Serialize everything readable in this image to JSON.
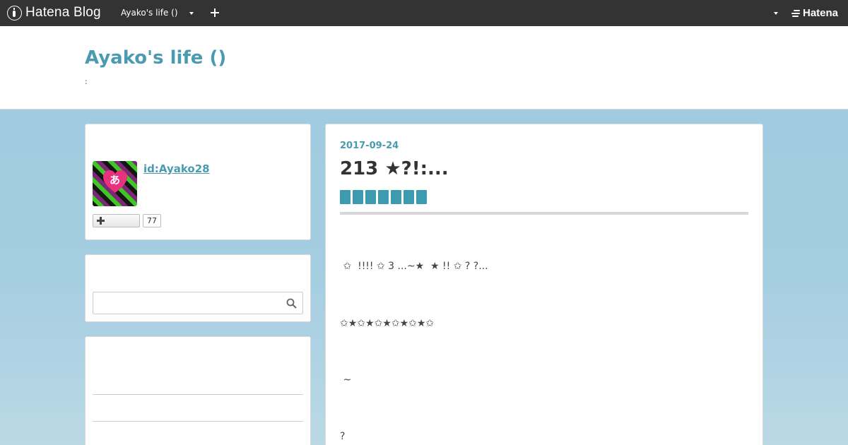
{
  "globalbar": {
    "logo_text": "Hatena Blog",
    "blog_name": "Ayako's life ()",
    "hatena_text": "Hatena"
  },
  "header": {
    "title": "Ayako's life ()",
    "description": ":"
  },
  "profile": {
    "avatar_char": "あ",
    "id": "id:Ayako28",
    "follower_count": "77"
  },
  "search": {
    "placeholder": ""
  },
  "entry": {
    "date": "2017-09-24",
    "title": "213 ★?!:...",
    "category_count": 7,
    "lines": [
      " ✩  !!!! ✩ 3 ...~★  ★ !! ✩ ? ?...",
      "✩★✩★✩★✩★✩★✩",
      " ~",
      "?"
    ]
  },
  "colors": {
    "accent": "#4a9bb1",
    "category": "#3d9bb0",
    "topbar": "#333333"
  }
}
